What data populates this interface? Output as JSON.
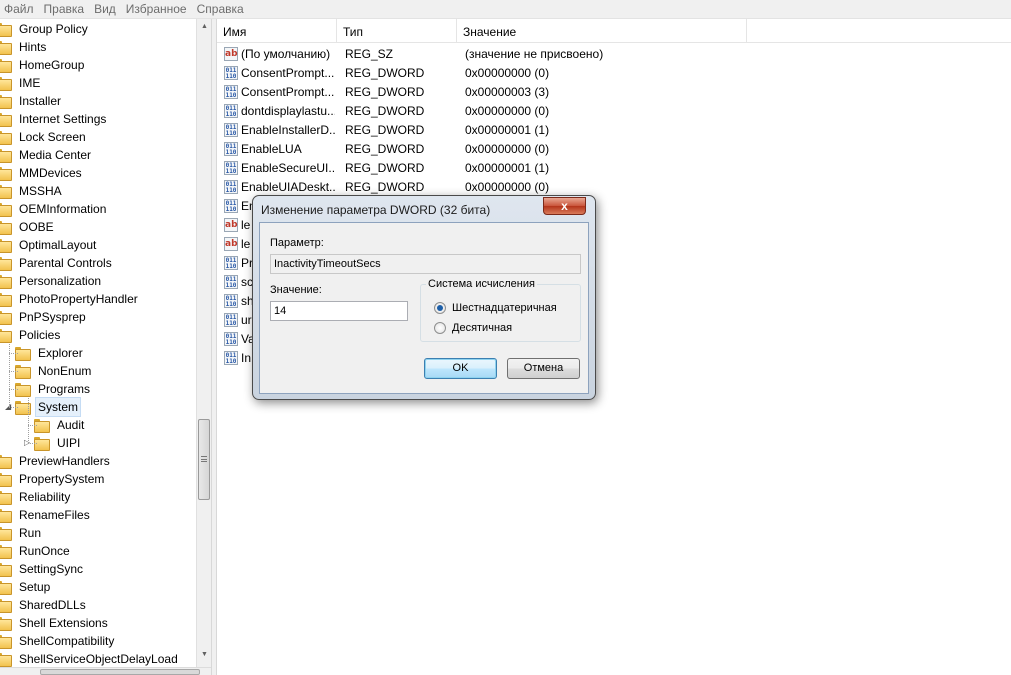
{
  "menu": [
    "Файл",
    "Правка",
    "Вид",
    "Избранное",
    "Справка"
  ],
  "tree": {
    "items": [
      {
        "label": "Group Policy",
        "level": 0
      },
      {
        "label": "Hints",
        "level": 0
      },
      {
        "label": "HomeGroup",
        "level": 0
      },
      {
        "label": "IME",
        "level": 0
      },
      {
        "label": "Installer",
        "level": 0
      },
      {
        "label": "Internet Settings",
        "level": 0
      },
      {
        "label": "Lock Screen",
        "level": 0
      },
      {
        "label": "Media Center",
        "level": 0
      },
      {
        "label": "MMDevices",
        "level": 0
      },
      {
        "label": "MSSHA",
        "level": 0
      },
      {
        "label": "OEMInformation",
        "level": 0
      },
      {
        "label": "OOBE",
        "level": 0
      },
      {
        "label": "OptimalLayout",
        "level": 0
      },
      {
        "label": "Parental Controls",
        "level": 0
      },
      {
        "label": "Personalization",
        "level": 0
      },
      {
        "label": "PhotoPropertyHandler",
        "level": 0
      },
      {
        "label": "PnPSysprep",
        "level": 0
      },
      {
        "label": "Policies",
        "level": 0
      },
      {
        "label": "Explorer",
        "level": 1
      },
      {
        "label": "NonEnum",
        "level": 1
      },
      {
        "label": "Programs",
        "level": 1
      },
      {
        "label": "System",
        "level": 1,
        "selected": true,
        "expanded": true
      },
      {
        "label": "Audit",
        "level": 2
      },
      {
        "label": "UIPI",
        "level": 2,
        "collapsed": true
      },
      {
        "label": "PreviewHandlers",
        "level": 0
      },
      {
        "label": "PropertySystem",
        "level": 0
      },
      {
        "label": "Reliability",
        "level": 0
      },
      {
        "label": "RenameFiles",
        "level": 0
      },
      {
        "label": "Run",
        "level": 0
      },
      {
        "label": "RunOnce",
        "level": 0
      },
      {
        "label": "SettingSync",
        "level": 0
      },
      {
        "label": "Setup",
        "level": 0
      },
      {
        "label": "SharedDLLs",
        "level": 0
      },
      {
        "label": "Shell Extensions",
        "level": 0
      },
      {
        "label": "ShellCompatibility",
        "level": 0
      },
      {
        "label": "ShellServiceObjectDelayLoad",
        "level": 0
      }
    ]
  },
  "list": {
    "columns": [
      "Имя",
      "Тип",
      "Значение"
    ],
    "rows": [
      {
        "icon": "ab",
        "name": "(По умолчанию)",
        "type": "REG_SZ",
        "value": "(значение не присвоено)"
      },
      {
        "icon": "bin",
        "name": "ConsentPrompt...",
        "type": "REG_DWORD",
        "value": "0x00000000 (0)"
      },
      {
        "icon": "bin",
        "name": "ConsentPrompt...",
        "type": "REG_DWORD",
        "value": "0x00000003 (3)"
      },
      {
        "icon": "bin",
        "name": "dontdisplaylastu...",
        "type": "REG_DWORD",
        "value": "0x00000000 (0)"
      },
      {
        "icon": "bin",
        "name": "EnableInstallerD...",
        "type": "REG_DWORD",
        "value": "0x00000001 (1)"
      },
      {
        "icon": "bin",
        "name": "EnableLUA",
        "type": "REG_DWORD",
        "value": "0x00000000 (0)"
      },
      {
        "icon": "bin",
        "name": "EnableSecureUI...",
        "type": "REG_DWORD",
        "value": "0x00000001 (1)"
      },
      {
        "icon": "bin",
        "name": "EnableUIADeskt...",
        "type": "REG_DWORD",
        "value": "0x00000000 (0)"
      },
      {
        "icon": "bin",
        "name": "En",
        "type": "",
        "value": ""
      },
      {
        "icon": "ab",
        "name": "le",
        "type": "",
        "value": ""
      },
      {
        "icon": "ab",
        "name": "le",
        "type": "",
        "value": ""
      },
      {
        "icon": "bin",
        "name": "Pr",
        "type": "",
        "value": ""
      },
      {
        "icon": "bin",
        "name": "sc",
        "type": "",
        "value": ""
      },
      {
        "icon": "bin",
        "name": "sh",
        "type": "",
        "value": ""
      },
      {
        "icon": "bin",
        "name": "ur",
        "type": "",
        "value": ""
      },
      {
        "icon": "bin",
        "name": "Va",
        "type": "",
        "value": ""
      },
      {
        "icon": "bin",
        "name": "In",
        "type": "",
        "value": ""
      }
    ]
  },
  "dialog": {
    "title": "Изменение параметра DWORD (32 бита)",
    "close_label": "x",
    "param_label": "Параметр:",
    "param_name": "InactivityTimeoutSecs",
    "value_label": "Значение:",
    "value": "14",
    "base_group_label": "Система исчисления",
    "base_options": [
      {
        "label": "Шестнадцатеричная",
        "checked": true
      },
      {
        "label": "Десятичная",
        "checked": false
      }
    ],
    "ok_label": "OK",
    "cancel_label": "Отмена"
  }
}
